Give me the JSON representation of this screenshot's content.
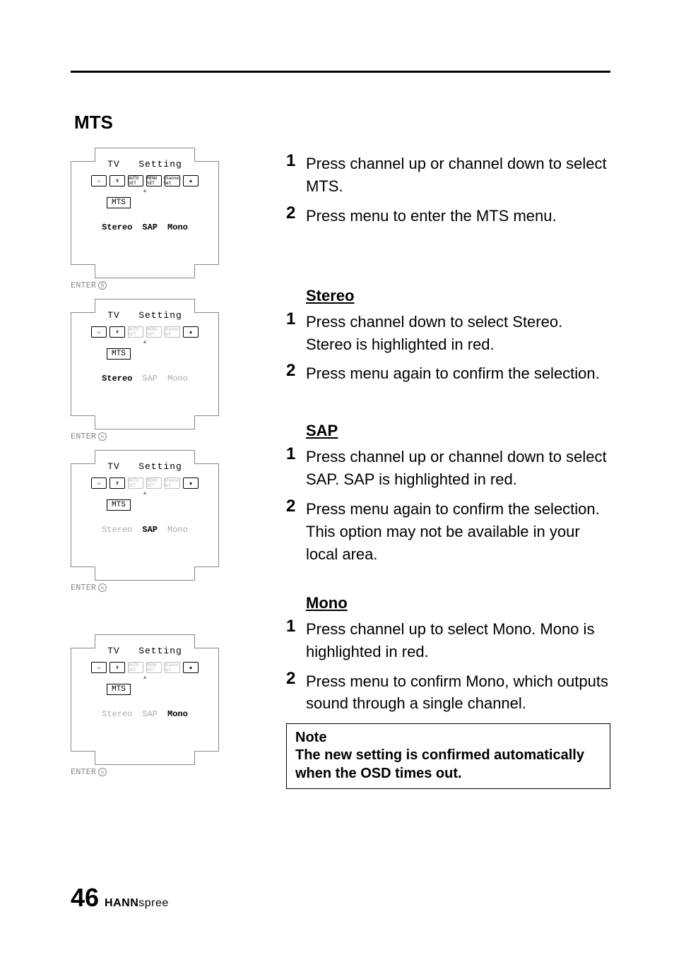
{
  "section_title": "MTS",
  "osd": {
    "title": "TV   Setting",
    "icon_labels": [
      "tv",
      "ant",
      "AUTO SET",
      "MENU SET",
      "Channel Set",
      "cc"
    ],
    "mts_label": "MTS",
    "options": [
      "Stereo",
      "SAP",
      "Mono"
    ],
    "enter_label": "ENTER"
  },
  "intro_steps": {
    "s1_num": "1",
    "s1_text": "Press channel up or channel down to select MTS.",
    "s2_num": "2",
    "s2_text": "Press menu to enter the MTS menu."
  },
  "stereo": {
    "heading": "Stereo",
    "s1_num": "1",
    "s1_text": "Press channel down to select Stereo. Stereo is highlighted in red.",
    "s2_num": "2",
    "s2_text": "Press menu again to confirm the selection."
  },
  "sap": {
    "heading": "SAP",
    "s1_num": "1",
    "s1_text": "Press channel up or channel down to select SAP. SAP is highlighted in red.",
    "s2_num": "2",
    "s2_text": "Press menu again to confirm the selection. This option may not be available in your local area."
  },
  "mono": {
    "heading": "Mono",
    "s1_num": "1",
    "s1_text": "Press channel up to select Mono. Mono is highlighted in red.",
    "s2_num": "2",
    "s2_text": "Press menu to confirm Mono, which outputs sound through a single channel."
  },
  "note": {
    "title": "Note",
    "text": "The new setting is confirmed automatically when the OSD times out."
  },
  "footer": {
    "page": "46",
    "brand_bold": "HANN",
    "brand_light": "spree"
  }
}
